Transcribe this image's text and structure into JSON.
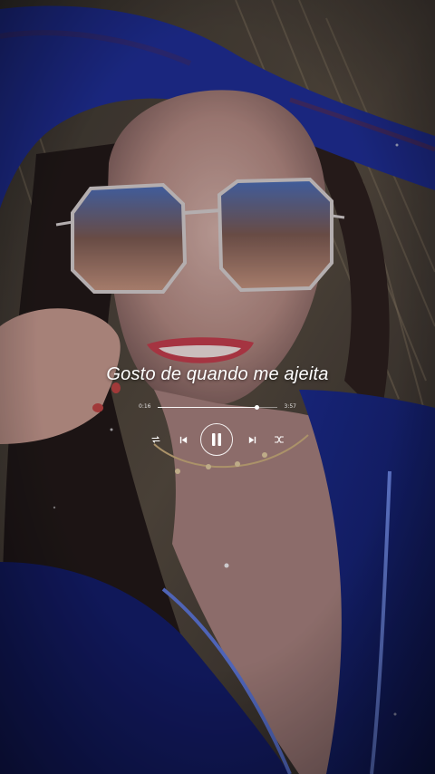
{
  "lyric": {
    "text": "Gosto de quando me ajeita"
  },
  "player": {
    "elapsed": "0:16",
    "total": "3:57",
    "progress": 0.83,
    "state": "playing",
    "icons": {
      "repeat": "repeat-icon",
      "previous": "previous-track-icon",
      "pause": "pause-icon",
      "next": "next-track-icon",
      "shuffle": "shuffle-icon"
    }
  },
  "colors": {
    "text": "#ffffff",
    "hood": "#1d2c8c",
    "jacket": "#16237a"
  }
}
